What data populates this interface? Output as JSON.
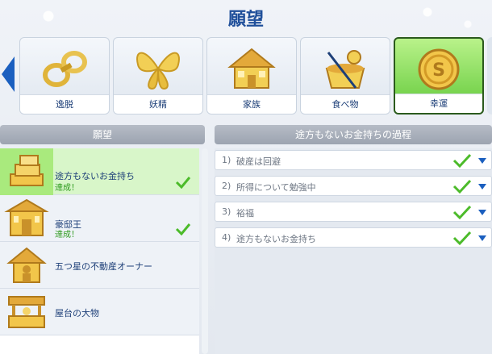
{
  "page_title": "願望",
  "colors": {
    "accent_green": "#62c93a",
    "title_blue": "#1f4f9a",
    "check_green": "#4cbb2a",
    "nav_blue": "#1b5fbf"
  },
  "tabs": [
    {
      "label": "逸脱",
      "icon": "handcuffs-icon",
      "active": false
    },
    {
      "label": "妖精",
      "icon": "butterfly-wings-icon",
      "active": false
    },
    {
      "label": "家族",
      "icon": "house-icon",
      "active": false
    },
    {
      "label": "食べ物",
      "icon": "cooking-pot-icon",
      "active": false
    },
    {
      "label": "幸運",
      "icon": "gold-coin-icon",
      "active": true
    }
  ],
  "list_panel": {
    "header": "願望",
    "items": [
      {
        "name": "途方もないお金持ち",
        "status": "達成！",
        "icon": "gold-bars-icon",
        "selected": true,
        "completed": true
      },
      {
        "name": "豪邸王",
        "status": "達成！",
        "icon": "mansion-icon",
        "selected": false,
        "completed": true
      },
      {
        "name": "五つ星の不動産オーナー",
        "status": "",
        "icon": "property-owner-icon",
        "selected": false,
        "completed": false
      },
      {
        "name": "屋台の大物",
        "status": "",
        "icon": "food-stall-icon",
        "selected": false,
        "completed": false
      }
    ]
  },
  "detail_panel": {
    "header": "途方もないお金持ちの過程",
    "steps": [
      {
        "num": "1)",
        "text": "破産は回避",
        "completed": true
      },
      {
        "num": "2)",
        "text": "所得について勉強中",
        "completed": true
      },
      {
        "num": "3)",
        "text": "裕福",
        "completed": true
      },
      {
        "num": "4)",
        "text": "途方もないお金持ち",
        "completed": true
      }
    ]
  }
}
